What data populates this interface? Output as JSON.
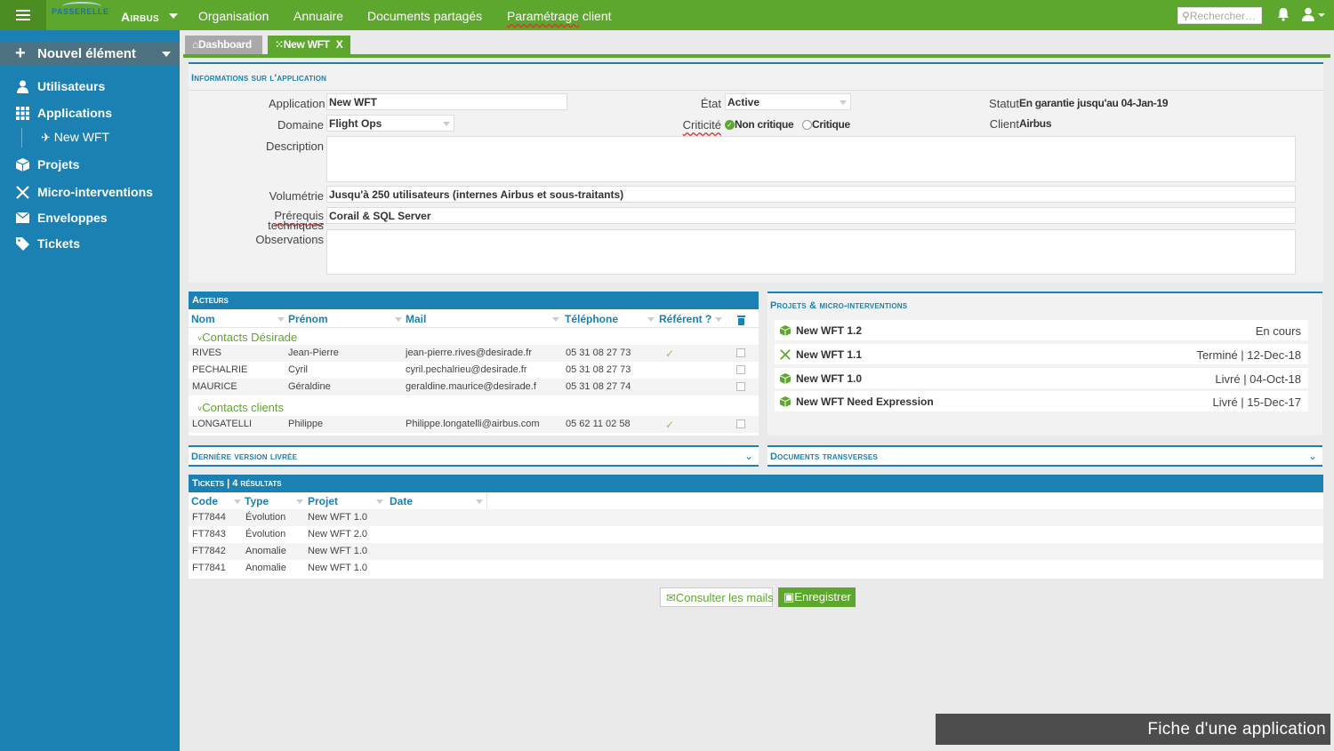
{
  "topbar": {
    "logo_text": "PASSERELLE",
    "client_name": "Airbus",
    "nav": [
      "Organisation",
      "Annuaire",
      "Documents partagés"
    ],
    "nav_param_word1": "Paramétrage",
    "nav_param_word2": "client",
    "search_placeholder": "Rechercher…"
  },
  "sidebar": {
    "new_element": "Nouvel élément",
    "items": [
      {
        "label": "Utilisateurs",
        "icon": "user-icon"
      },
      {
        "label": "Applications",
        "icon": "grid-icon"
      },
      {
        "label": "Projets",
        "icon": "cube-icon"
      },
      {
        "label": "Micro-interventions",
        "icon": "tools-icon"
      },
      {
        "label": "Enveloppes",
        "icon": "envelope-icon"
      },
      {
        "label": "Tickets",
        "icon": "tag-icon"
      }
    ],
    "sub_item": "New WFT"
  },
  "tabs": {
    "dashboard": "Dashboard",
    "current": "New WFT",
    "close": "X"
  },
  "app_info": {
    "title": "Informations sur l'application",
    "application_label": "Application",
    "application_value": "New WFT",
    "domaine_label": "Domaine",
    "domaine_value": "Flight Ops",
    "description_label": "Description",
    "volumetrie_label": "Volumétrie",
    "volumetrie_value": "Jusqu'à 250 utilisateurs (internes Airbus et sous-traitants)",
    "prerequis_label_1": "Prérequis",
    "prerequis_label_2": "techniques",
    "prerequis_value": "Corail & SQL Server",
    "observations_label": "Observations",
    "etat_label": "État",
    "etat_value": "Active",
    "criticite_label": "Criticité",
    "criticite_opt1": "Non critique",
    "criticite_opt2": "Critique",
    "statut_label": "Statut",
    "statut_value": "En garantie jusqu'au 04-Jan-19",
    "client_label": "Client",
    "client_value": "Airbus"
  },
  "acteurs": {
    "title": "Acteurs",
    "columns": [
      "Nom",
      "Prénom",
      "Mail",
      "Téléphone",
      "Référent ?"
    ],
    "groups": [
      {
        "name": "Contacts Désirade",
        "rows": [
          {
            "nom": "RIVES",
            "prenom": "Jean-Pierre",
            "mail": "jean-pierre.rives@desirade.fr",
            "tel": "05 31 08 27 73",
            "referent": true
          },
          {
            "nom": "PECHALRIE",
            "prenom": "Cyril",
            "mail": "cyril.pechalrieu@desirade.fr",
            "tel": "05 31 08 27 73",
            "referent": false
          },
          {
            "nom": "MAURICE",
            "prenom": "Géraldine",
            "mail": "geraldine.maurice@desirade.f",
            "tel": "05 31 08 27 74",
            "referent": false
          }
        ]
      },
      {
        "name": "Contacts clients",
        "rows": [
          {
            "nom": "LONGATELLI",
            "prenom": "Philippe",
            "mail": "Philippe.longatelli@airbus.com",
            "tel": "05 62 11 02 58",
            "referent": true
          }
        ]
      }
    ]
  },
  "projets": {
    "title": "Projets & micro-interventions",
    "items": [
      {
        "name": "New WFT 1.2",
        "status": "En cours",
        "icon": "cube-icon"
      },
      {
        "name": "New WFT 1.1",
        "status": "Terminé | 12-Dec-18",
        "icon": "tools-icon"
      },
      {
        "name": "New WFT 1.0",
        "status": "Livré | 04-Oct-18",
        "icon": "cube-icon"
      },
      {
        "name": "New WFT Need Expression",
        "status": "Livré | 15-Dec-17",
        "icon": "cube-icon"
      }
    ]
  },
  "derniere_version": {
    "title": "Dernière version livrée"
  },
  "documents": {
    "title": "Documents transverses"
  },
  "tickets": {
    "title": "Tickets | 4 résultats",
    "columns": [
      "Code",
      "Type",
      "Projet",
      "Date"
    ],
    "rows": [
      {
        "code": "FT7844",
        "type": "Évolution",
        "projet": "New WFT 1.0"
      },
      {
        "code": "FT7843",
        "type": "Évolution",
        "projet": "New WFT 2.0"
      },
      {
        "code": "FT7842",
        "type": "Anomalie",
        "projet": "New WFT 1.0"
      },
      {
        "code": "FT7841",
        "type": "Anomalie",
        "projet": "New WFT 1.0"
      }
    ]
  },
  "buttons": {
    "mail": "Consulter les mails",
    "save": "Enregistrer"
  },
  "caption": "Fiche d'une application",
  "colors": {
    "green": "#5ea72e",
    "blue": "#1b81b3",
    "sidebar_header": "#4d7282"
  }
}
